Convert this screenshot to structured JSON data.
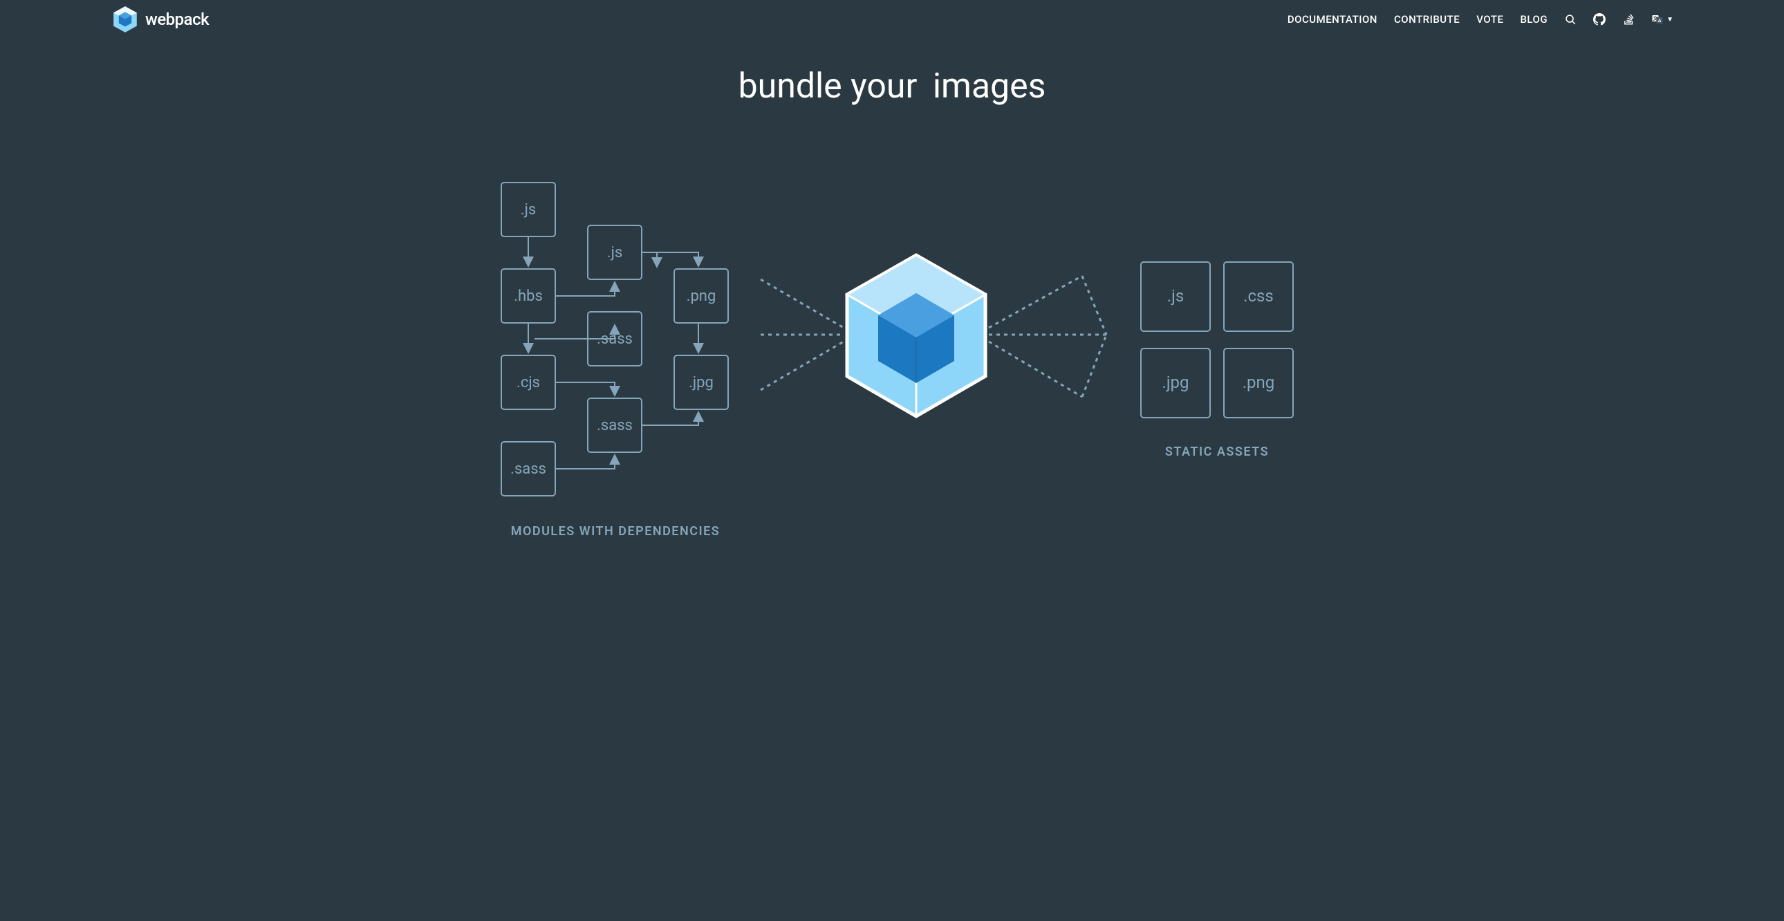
{
  "header": {
    "brand": "webpack",
    "nav": {
      "documentation": "DOCUMENTATION",
      "contribute": "CONTRIBUTE",
      "vote": "VOTE",
      "blog": "BLOG"
    }
  },
  "hero": {
    "prefix": "bundle your",
    "dynamic_word": "images"
  },
  "diagram": {
    "modules_label": "MODULES WITH DEPENDENCIES",
    "assets_label": "STATIC ASSETS",
    "input_boxes": {
      "b0": ".js",
      "b1": ".js",
      "b2": ".hbs",
      "b3": ".png",
      "b4": ".sass",
      "b5": ".cjs",
      "b6": ".jpg",
      "b7": ".sass",
      "b8": ".sass"
    },
    "output_boxes": {
      "o0": ".js",
      "o1": ".css",
      "o2": ".jpg",
      "o3": ".png"
    }
  }
}
